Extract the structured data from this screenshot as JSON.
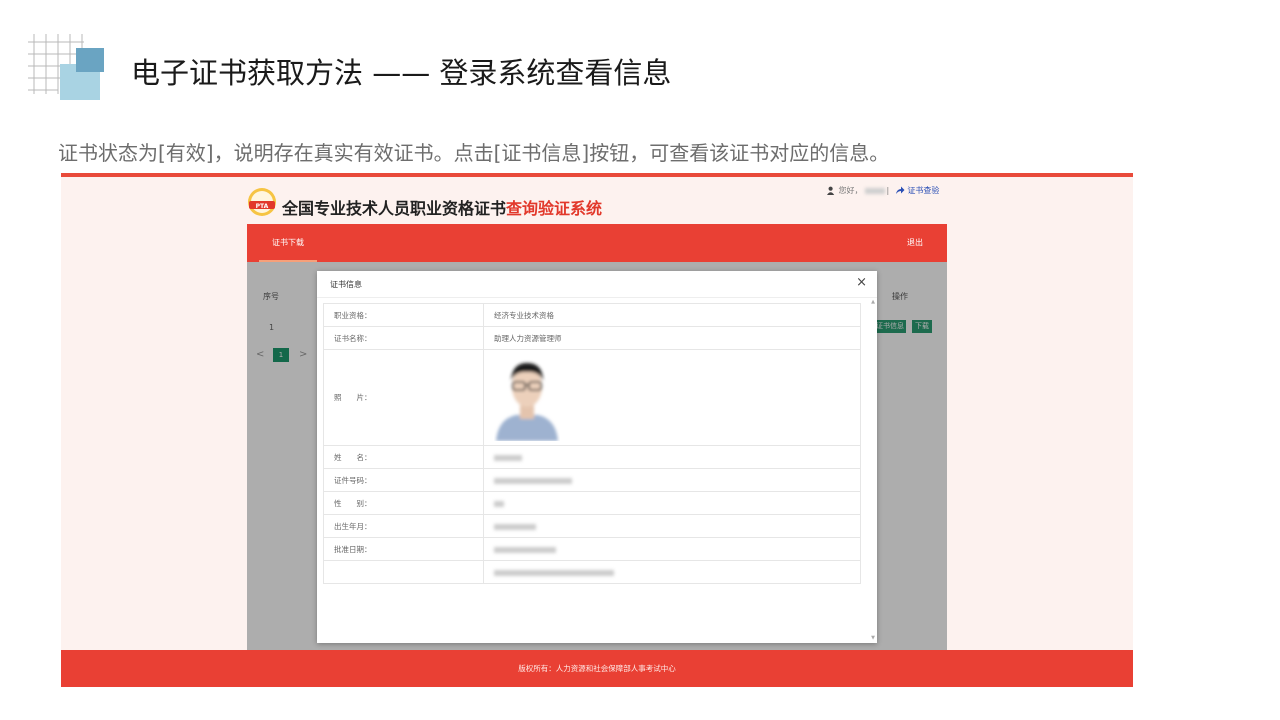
{
  "slide": {
    "title": "电子证书获取方法 —— 登录系统查看信息",
    "description": "证书状态为[有效]，说明存在真实有效证书。点击[证书信息]按钮，可查看该证书对应的信息。"
  },
  "site": {
    "title_main": "全国专业技术人员职业资格证书",
    "title_accent": "查询验证系统",
    "logo_text": "PTA",
    "user_greeting": "您好，",
    "user_separator": "|",
    "verify_link": "证书查验",
    "nav_tab": "证书下载",
    "logout": "退出",
    "footer": "版权所有：人力资源和社会保障部人事考试中心"
  },
  "background_table": {
    "col_no": "序号",
    "col_action": "操作",
    "row_no": "1",
    "btn_info": "证书信息",
    "btn_download": "下载",
    "pager_prev": "<",
    "pager_page": "1",
    "pager_next": ">"
  },
  "modal": {
    "title": "证书信息",
    "close": "×",
    "rows": {
      "qualification_label": "职业资格：",
      "qualification_value": "经济专业技术资格",
      "cert_name_label": "证书名称：",
      "cert_name_value": "助理人力资源管理师",
      "photo_label": "照　　片：",
      "name_label": "姓　　名：",
      "id_label": "证件号码：",
      "gender_label": "性　　别：",
      "birth_label": "出生年月：",
      "approve_label": "批准日期："
    }
  },
  "colors": {
    "brand_red": "#e94034",
    "accent_green": "#2b9e74",
    "link_blue": "#2a4fb5"
  },
  "icons": [
    "grid-logo-icon",
    "pta-logo-icon",
    "user-icon",
    "share-arrow-icon",
    "close-icon"
  ]
}
